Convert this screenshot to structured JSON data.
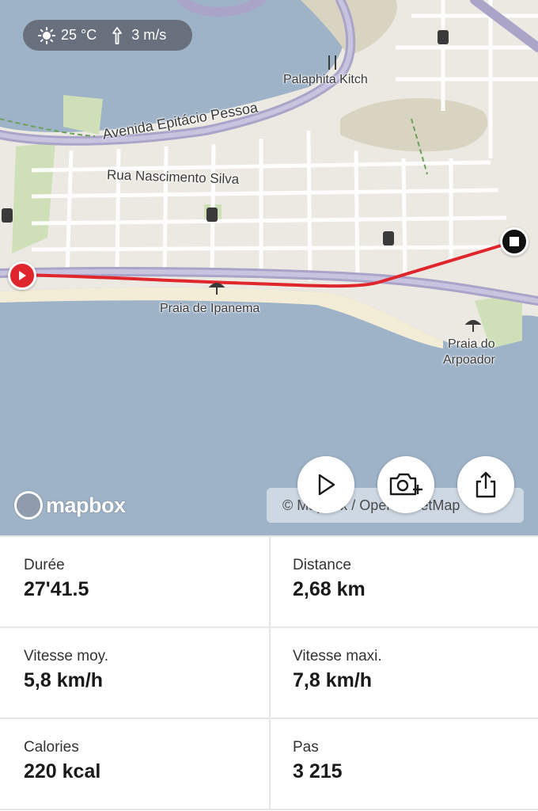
{
  "weather": {
    "temperature": "25 °C",
    "wind": "3 m/s",
    "temperature_icon": "sun-icon",
    "wind_icon": "wind-direction-icon"
  },
  "map": {
    "labels": {
      "avenida": "Avenida Epitácio Pessoa",
      "rua": "Rua Nascimento Silva",
      "palaphita": "Palaphita Kitch",
      "praia_ipanema": "Praia de Ipanema",
      "praia_arpoador_line1": "Praia do",
      "praia_arpoador_line2": "Arpoador"
    },
    "route_color": "#e0262d",
    "start_marker_color": "#e0262d",
    "end_marker_color": "#111111",
    "water_color": "#9fb3c8",
    "land_color": "#ece9e2"
  },
  "controls": {
    "play_icon": "play-icon",
    "camera_icon": "add-photo-icon",
    "share_icon": "share-icon"
  },
  "attribution": {
    "logo_text": "mapbox",
    "text": "© Mapbox / OpenStreetMap"
  },
  "stats": [
    {
      "label": "Durée",
      "value": "27'41.5"
    },
    {
      "label": "Distance",
      "value": "2,68 km"
    },
    {
      "label": "Vitesse moy.",
      "value": "5,8 km/h"
    },
    {
      "label": "Vitesse maxi.",
      "value": "7,8 km/h"
    },
    {
      "label": "Calories",
      "value": "220 kcal"
    },
    {
      "label": "Pas",
      "value": "3 215"
    }
  ]
}
